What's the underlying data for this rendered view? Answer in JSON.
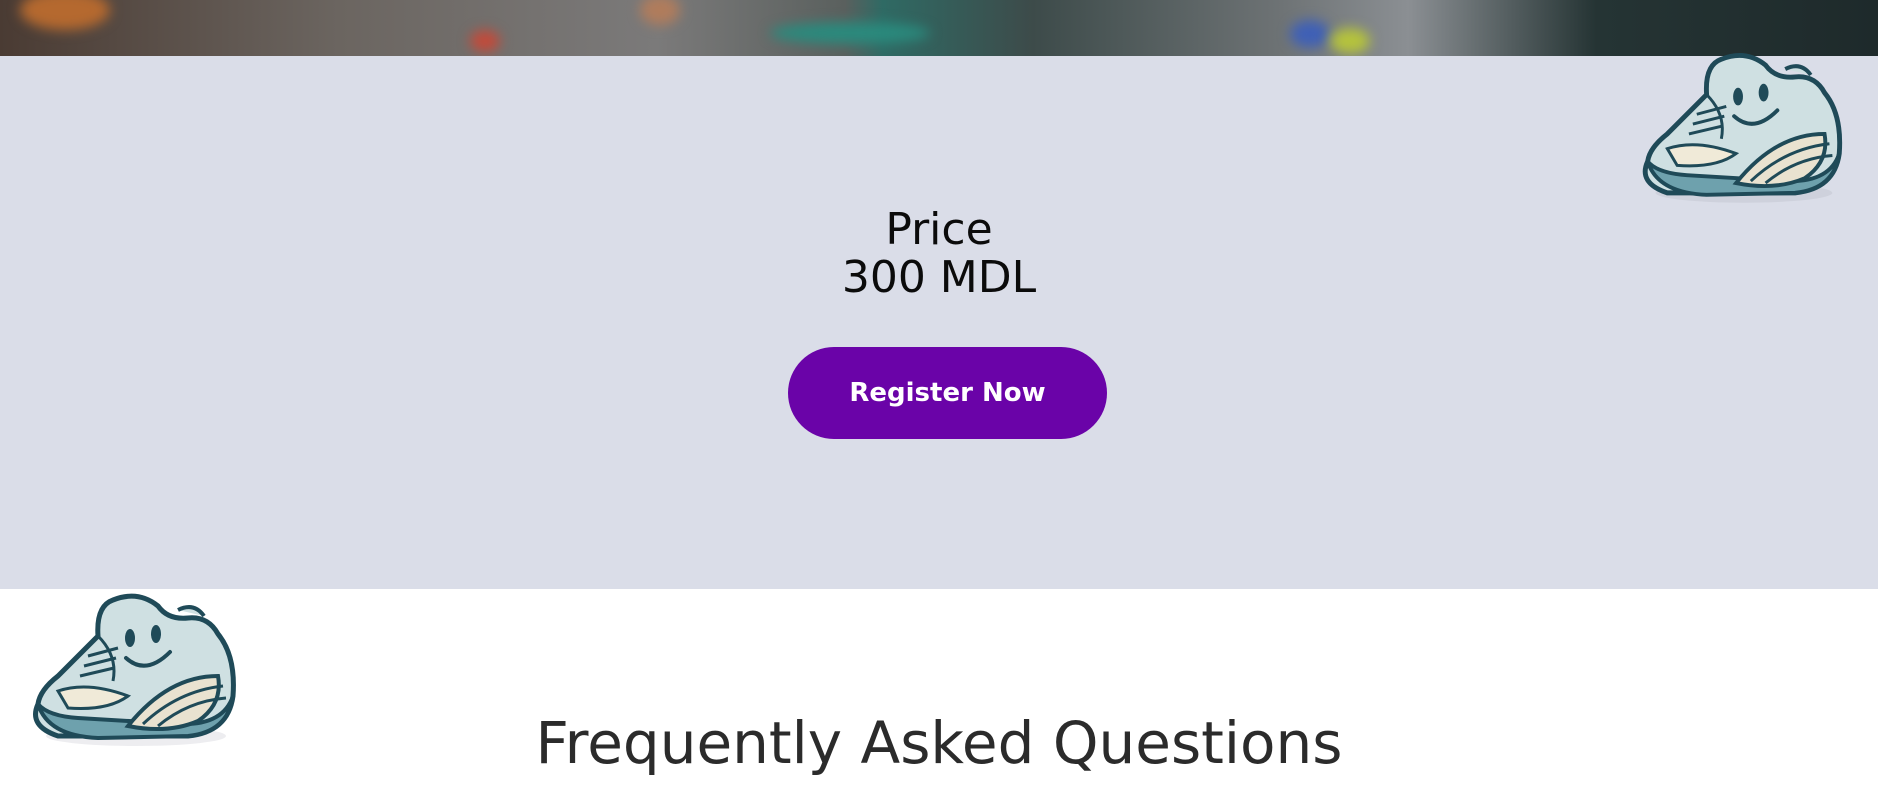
{
  "pricing": {
    "label": "Price",
    "value": "300 MDL",
    "cta_label": "Register Now"
  },
  "faq": {
    "title": "Frequently Asked Questions"
  },
  "colors": {
    "price_section_bg": "#dadde8",
    "cta_bg": "#6a03a8",
    "cta_text": "#ffffff"
  },
  "decorations": {
    "mascot_icon": "smiling-sneaker-icon"
  }
}
